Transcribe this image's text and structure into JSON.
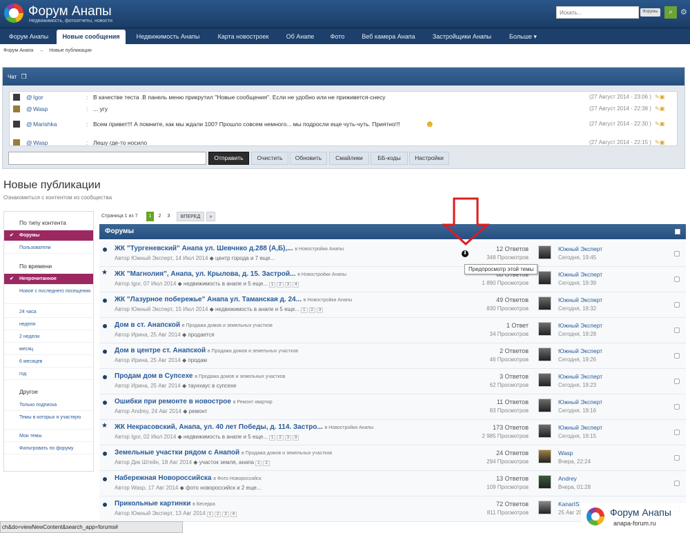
{
  "header": {
    "title": "Форум Анапы",
    "subtitle": "Недвижимость, фотоотчеты, новости",
    "search_placeholder": "Искать...",
    "search_scope": "Форумы"
  },
  "nav": {
    "items": [
      {
        "label": "Форум Анапы"
      },
      {
        "label": "Новые сообщения"
      },
      {
        "label": "Недвижимость Анапы"
      },
      {
        "label": "Карта новостроек"
      },
      {
        "label": "Об Анапе"
      },
      {
        "label": "Фото"
      },
      {
        "label": "Веб камера Анапа"
      },
      {
        "label": "Застройщики Анапы"
      },
      {
        "label": "Больше ▾"
      }
    ]
  },
  "breadcrumb": {
    "root": "Форум Анапа",
    "sep": "→",
    "current": "Новые публикации"
  },
  "chat": {
    "title": "Чат",
    "messages": [
      {
        "user": "Igor",
        "text": "В качестве теста .В панель меню прикрутил \"Новые сообщения\". Если не удобно или не приживется-снесу",
        "time": "(27 Август 2014 - 23:06 )"
      },
      {
        "user": "Wasp",
        "text": "... угу",
        "time": "(27 Август 2014 - 22:38 )"
      },
      {
        "user": "Marishka",
        "text": "Всем привет!!! А помните, как мы ждали 100? Прошло совсем немного... мы подросли еще чуть-чуть. Приятно!!!",
        "time": "(27 Август 2014 - 22:30 )"
      },
      {
        "user": "Wasp",
        "text": "Лешу где-то носило",
        "time": "(27 Август 2014 - 22:15 )"
      }
    ],
    "buttons": {
      "send": "Отправить",
      "clear": "Очистить",
      "refresh": "Обновить",
      "smilies": "Смайлики",
      "bbcodes": "ББ-коды",
      "settings": "Настройки"
    }
  },
  "page": {
    "title": "Новые публикации",
    "subtitle": "Ознакомиться с контентом из сообщества"
  },
  "sidebar": {
    "by_type": "По типу контента",
    "type_items": [
      "Форумы",
      "Пользователи"
    ],
    "by_time": "По времени",
    "time_items": [
      "Непрочитанное",
      "Новое с последнего посещения",
      "24 часа",
      "неделя",
      "2 недели",
      "месяц",
      "6 месяцев",
      "год"
    ],
    "other": "Другое",
    "other_items": [
      "Только подписка",
      "Темы в которых я участвую",
      "Мои темы",
      "Фильтровать по форуму"
    ]
  },
  "pager": {
    "label": "Страница 1 из 7",
    "pages": [
      "1",
      "2",
      "3"
    ],
    "next": "ВПЕРЕД",
    "last": "»"
  },
  "forums_header": "Форумы",
  "tooltip": "Предпросмотр этой темы",
  "topics": [
    {
      "title": "ЖК \"Тургеневский\" Анапа ул. Шевчнко д.288 (А,Б),...",
      "forum": "в Новостройки Анапы",
      "author": "Автор Южный Эксперт, 14 Июл 2014",
      "tags": "центр города и 7 еще...",
      "pages": [],
      "replies": "12 Ответов",
      "views": "348 Просмотров",
      "last_user": "Южный Эксперт",
      "last_date": "Сегодня, 19:45"
    },
    {
      "title": "ЖК \"Магнолия\", Анапа, ул. Крылова, д. 15. Застрой...",
      "forum": "в Новостройки Анапы",
      "author": "Автор Igor, 07 Июл 2014",
      "tags": "недвижимость в анапе и 5 еще...",
      "pages": [
        "1",
        "2",
        "3",
        "4"
      ],
      "replies": "68 Ответов",
      "views": "1 890 Просмотров",
      "last_user": "Южный Эксперт",
      "last_date": "Сегодня, 19:39"
    },
    {
      "title": "ЖК \"Лазурное побережье\" Анапа ул. Таманская д. 24...",
      "forum": "в Новостройки Анапы",
      "author": "Автор Южный Эксперт, 15 Июл 2014",
      "tags": "недвижимость в анапе и 5 еще...",
      "pages": [
        "1",
        "2",
        "3"
      ],
      "replies": "49 Ответов",
      "views": "830 Просмотров",
      "last_user": "Южный Эксперт",
      "last_date": "Сегодня, 19:32"
    },
    {
      "title": "Дом в ст. Анапской",
      "forum": "в Продажа домов и земельных участков",
      "author": "Автор Ирина, 25 Авг 2014",
      "tags": "продается",
      "pages": [],
      "replies": "1 Ответ",
      "views": "34 Просмотров",
      "last_user": "Южный Эксперт",
      "last_date": "Сегодня, 19:28"
    },
    {
      "title": "Дом в центре ст. Анапской",
      "forum": "в Продажа домов и земельных участков",
      "author": "Автор Ирина, 25 Авг 2014",
      "tags": "продам",
      "pages": [],
      "replies": "2 Ответов",
      "views": "46 Просмотров",
      "last_user": "Южный Эксперт",
      "last_date": "Сегодня, 19:26"
    },
    {
      "title": "Продам дом в Супсехе",
      "forum": "в Продажа домов и земельных участков",
      "author": "Автор Ирина, 25 Авг 2014",
      "tags": "таунхаус в супсехе",
      "pages": [],
      "replies": "3 Ответов",
      "views": "62 Просмотров",
      "last_user": "Южный Эксперт",
      "last_date": "Сегодня, 19:23"
    },
    {
      "title": "Ошибки при ремонте в новострое",
      "forum": "в Ремонт квартир",
      "author": "Автор Andrey, 24 Авг 2014",
      "tags": "ремонт",
      "pages": [],
      "replies": "11 Ответов",
      "views": "83 Просмотров",
      "last_user": "Южный Эксперт",
      "last_date": "Сегодня, 19:16"
    },
    {
      "title": "ЖК Некрасовский, Анапа, ул. 40 лет Победы, д. 114. Застро...",
      "forum": "в Новостройки Анапы",
      "author": "Автор Igor, 02 Июл 2014",
      "tags": "недвижимость в анапе и 5 еще...",
      "pages": [
        "1",
        "2",
        "3",
        "9"
      ],
      "replies": "173 Ответов",
      "views": "2 985 Просмотров",
      "last_user": "Южный Эксперт",
      "last_date": "Сегодня, 19:15"
    },
    {
      "title": "Земельные участки рядом с Анапой",
      "forum": "в Продажа домов и земельных участков",
      "author": "Автор Дик Штейн, 18 Авг 2014",
      "tags": "участок земля, анапа",
      "pages": [
        "1",
        "2"
      ],
      "replies": "24 Ответов",
      "views": "294 Просмотров",
      "last_user": "Wasp",
      "last_date": "Вчера, 22:24"
    },
    {
      "title": "Набережная Новороссийска",
      "forum": "в Фото Новороссийск",
      "author": "Автор Wasp, 17 Авг 2014",
      "tags": "фото новороссийск и 2 еще...",
      "pages": [],
      "replies": "13 Ответов",
      "views": "109 Просмотров",
      "last_user": "Andrey",
      "last_date": "Вчера, 01:28"
    },
    {
      "title": "Прикольные картинки",
      "forum": "в Беседка",
      "author": "Автор Южный Эксперт, 13 Авг 2014",
      "tags": "",
      "pages": [
        "1",
        "2",
        "3",
        "4"
      ],
      "replies": "72 Ответов",
      "views": "811 Просмотров",
      "last_user": "KanarIS",
      "last_date": "25 Авг 20"
    }
  ],
  "statusbar": "ch&do=viewNewContent&search_app=forums#",
  "watermark": {
    "name": "Форум Анапы",
    "url": "anapa-forum.ru"
  }
}
